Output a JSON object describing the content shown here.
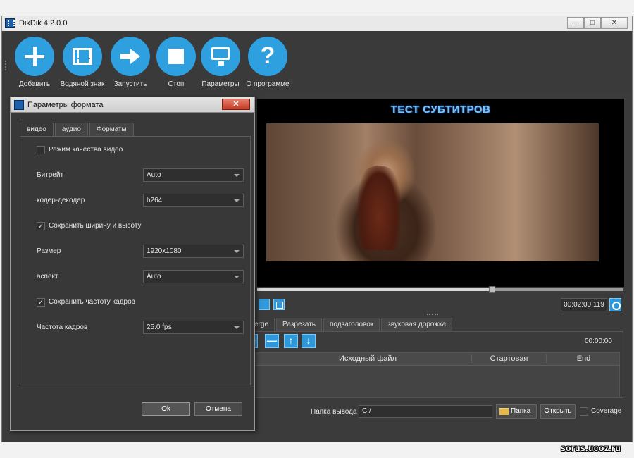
{
  "window": {
    "title": "DikDik 4.2.0.0",
    "min_symbol": "—",
    "max_symbol": "□",
    "close_symbol": "✕"
  },
  "toolbar": {
    "items": [
      {
        "label": "Добавить",
        "icon": "plus-icon"
      },
      {
        "label": "Водяной знак",
        "icon": "film-icon"
      },
      {
        "label": "Запустить",
        "icon": "arrow-right-icon"
      },
      {
        "label": "Стоп",
        "icon": "stop-icon"
      },
      {
        "label": "Параметры",
        "icon": "monitor-icon"
      },
      {
        "label": "О программе",
        "icon": "question-icon"
      }
    ],
    "question_glyph": "?"
  },
  "preview": {
    "subtitle_text": "ТЕСТ СУБТИТРОВ",
    "time": "00:02:00:119",
    "progress": 0.64
  },
  "bottom_tabs": [
    "erge",
    "Разрезать",
    "подзаголовок",
    "звуковая дорожка"
  ],
  "panel": {
    "time": "00:00:00",
    "buttons": [
      "+",
      "—",
      "↑",
      "↓"
    ],
    "columns": {
      "source": "Исходный файл",
      "start": "Стартовая",
      "end": "End"
    }
  },
  "output": {
    "label": "Папка вывода",
    "path": "C:/",
    "folder_button": "Папка",
    "open_button": "Открыть",
    "coverage_label": "Coverage"
  },
  "dialog": {
    "title": "Параметры формата",
    "close": "✕",
    "tabs": [
      "видео",
      "аудио",
      "Форматы"
    ],
    "quality_mode_label": "Режим качества видео",
    "bitrate_label": "Битрейт",
    "bitrate_value": "Auto",
    "codec_label": "кодер-декодер",
    "codec_value": "h264",
    "keep_size_label": "Сохранить ширину и высоту",
    "keep_size_check": "✓",
    "size_label": "Размер",
    "size_value": "1920x1080",
    "aspect_label": "аспект",
    "aspect_value": "Auto",
    "keep_fps_label": "Сохранить частоту кадров",
    "keep_fps_check": "✓",
    "fps_label": "Частота кадров",
    "fps_value": "25.0 fps",
    "ok": "Ok",
    "cancel": "Отмена"
  },
  "watermark": "sorus.ucoz.ru",
  "colors": {
    "accent": "#2ea0e0",
    "background": "#3b3b3b"
  }
}
